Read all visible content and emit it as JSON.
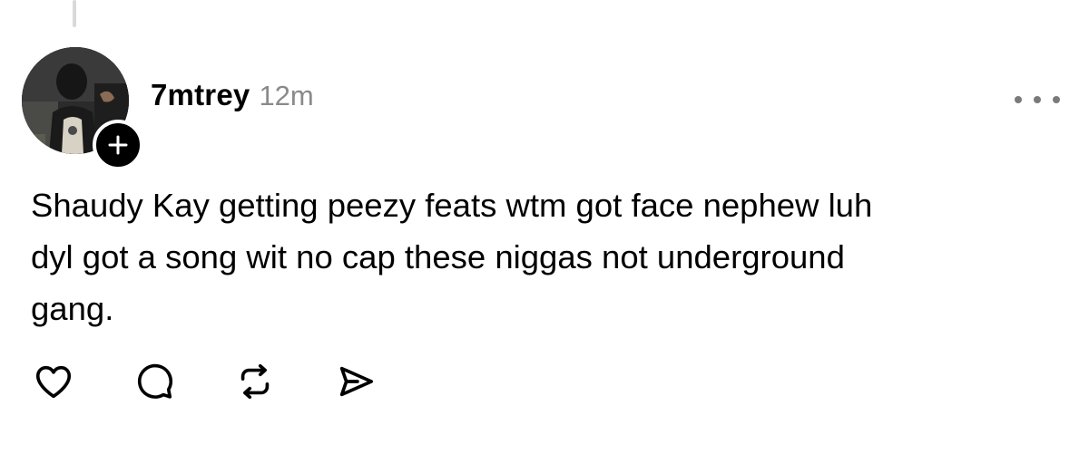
{
  "post": {
    "username": "7mtrey",
    "timestamp": "12m",
    "text_lines": [
      "Shaudy Kay getting peezy feats wtm got face nephew luh",
      "dyl got a song wit no cap these niggas not underground",
      "gang."
    ]
  },
  "icons": {
    "follow": "plus-icon",
    "more": "more-horizontal-icon",
    "like": "heart-icon",
    "reply": "comment-icon",
    "repost": "repost-icon",
    "share": "send-icon"
  },
  "colors": {
    "text": "#000000",
    "muted": "#8a8a8a",
    "thread_line": "#d9d9d9",
    "badge": "#000000"
  }
}
